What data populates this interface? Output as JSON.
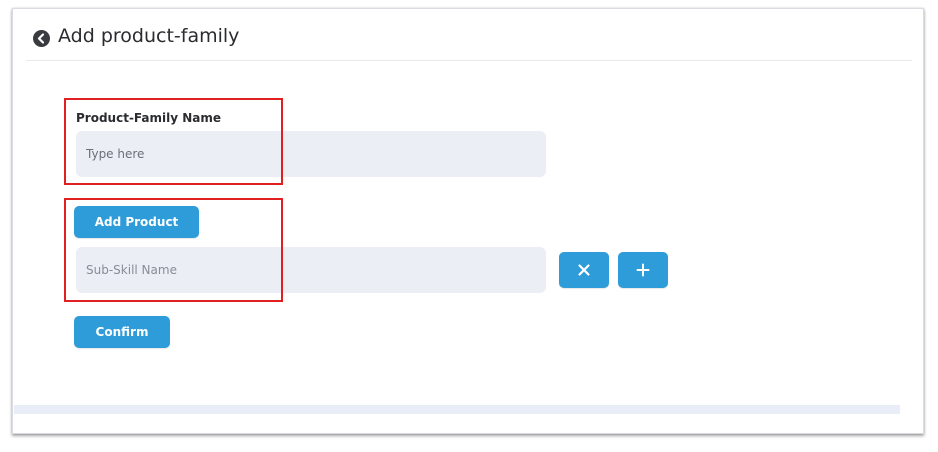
{
  "header": {
    "title": "Add product-family",
    "back_icon": "chevron-left-circle-icon"
  },
  "form": {
    "product_family": {
      "label": "Product-Family Name",
      "placeholder": "Type here",
      "value": ""
    },
    "add_product_label": "Add Product",
    "sub_skill": {
      "placeholder": "Sub-Skill Name",
      "value": "",
      "remove_icon": "close-icon",
      "add_icon": "plus-icon"
    },
    "confirm_label": "Confirm"
  },
  "colors": {
    "primary_button": "#2e9cd9",
    "input_background": "#eceef6",
    "highlight_border": "#e02020",
    "title_text": "#2b2c30"
  }
}
